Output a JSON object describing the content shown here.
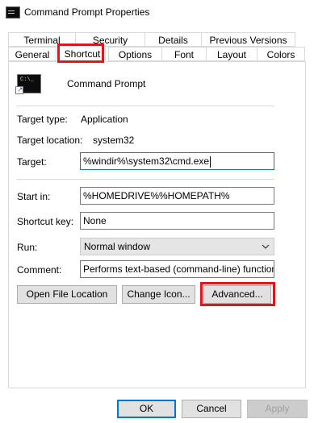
{
  "window": {
    "title": "Command Prompt Properties",
    "icon": "command-prompt-icon"
  },
  "tabs_row1": [
    "Terminal",
    "Security",
    "Details",
    "Previous Versions"
  ],
  "tabs_row2": [
    "General",
    "Shortcut",
    "Options",
    "Font",
    "Layout",
    "Colors"
  ],
  "active_tab": "Shortcut",
  "shortcut": {
    "name": "Command Prompt",
    "icon": "command-prompt-icon",
    "icon_prompt": "C:\\_",
    "target_type_label": "Target type:",
    "target_type": "Application",
    "target_location_label": "Target location:",
    "target_location": "system32",
    "target_label": "Target:",
    "target": "%windir%\\system32\\cmd.exe",
    "start_in_label": "Start in:",
    "start_in": "%HOMEDRIVE%%HOMEPATH%",
    "shortcut_key_label": "Shortcut key:",
    "shortcut_key": "None",
    "run_label": "Run:",
    "run": "Normal window",
    "comment_label": "Comment:",
    "comment": "Performs text-based (command-line) functions.",
    "open_file_location": "Open File Location",
    "change_icon": "Change Icon...",
    "advanced": "Advanced..."
  },
  "footer": {
    "ok": "OK",
    "cancel": "Cancel",
    "apply": "Apply"
  },
  "colors": {
    "highlight": "#e4141b",
    "focus": "#0078d7"
  }
}
